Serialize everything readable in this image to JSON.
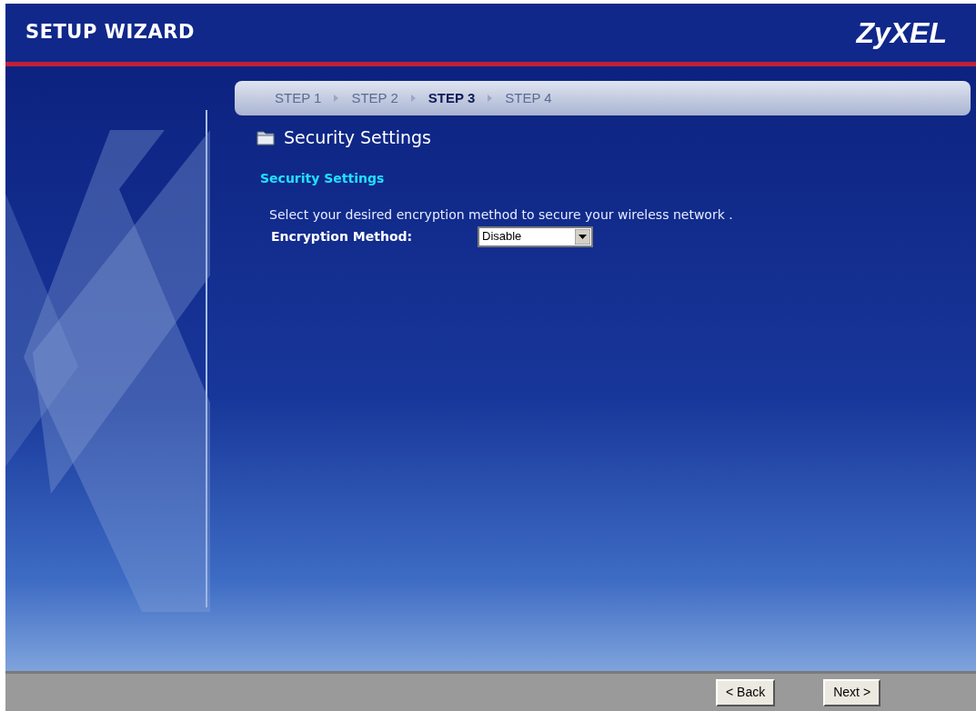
{
  "header": {
    "title": "SETUP WIZARD",
    "logo": "ZyXEL"
  },
  "steps": [
    {
      "label": "STEP 1",
      "selected": false
    },
    {
      "label": "STEP 2",
      "selected": false
    },
    {
      "label": "STEP 3",
      "selected": true
    },
    {
      "label": "STEP 4",
      "selected": false
    }
  ],
  "page_title": "Security Settings",
  "section": {
    "heading": "Security Settings",
    "description": "Select your desired encryption method to secure your wireless network .",
    "field_label": "Encryption Method:",
    "select_value": "Disable"
  },
  "buttons": [
    "< Back",
    "Next >"
  ]
}
